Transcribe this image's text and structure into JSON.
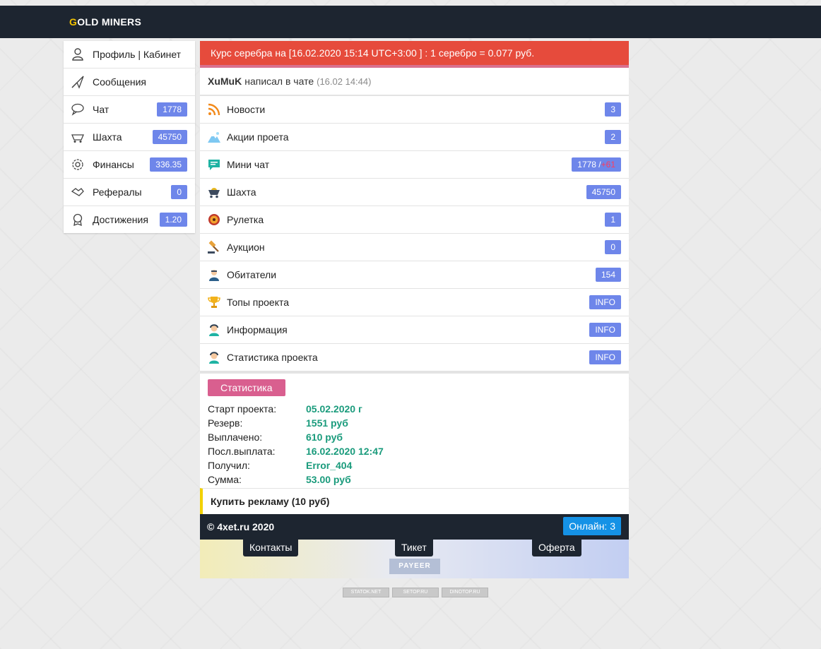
{
  "header": {
    "logo_first": "G",
    "logo_rest": "OLD MINERS"
  },
  "sidebar": {
    "items": [
      {
        "label": "Профиль | Кабинет",
        "icon": "user-icon"
      },
      {
        "label": "Сообщения",
        "icon": "paper-plane-icon"
      },
      {
        "label": "Чат",
        "icon": "chat-bubble-icon",
        "badge": "1778"
      },
      {
        "label": "Шахта",
        "icon": "mine-cart-icon",
        "badge": "45750"
      },
      {
        "label": "Финансы",
        "icon": "gear-coin-icon",
        "badge": "336.35"
      },
      {
        "label": "Рефералы",
        "icon": "handshake-icon",
        "badge": "0"
      },
      {
        "label": "Достижения",
        "icon": "medal-icon",
        "badge": "1.20"
      }
    ]
  },
  "rate_bar": {
    "text": "Курс серебра на [16.02.2020 15:14 UTC+3:00 ] : 1 серебро = 0.077 руб."
  },
  "chat_line": {
    "nick": "XuMuK",
    "text": "написал в чате",
    "time": "(16.02 14:44)"
  },
  "menu": {
    "items": [
      {
        "label": "Новости",
        "icon": "rss-icon",
        "badge": "3"
      },
      {
        "label": "Акции проета",
        "icon": "mountain-icon",
        "badge": "2"
      },
      {
        "label": "Мини чат",
        "icon": "message-icon",
        "badge": "1778 /",
        "badge_extra": "+61"
      },
      {
        "label": "Шахта",
        "icon": "mine-cart-icon",
        "badge": "45750"
      },
      {
        "label": "Рулетка",
        "icon": "roulette-icon",
        "badge": "1"
      },
      {
        "label": "Аукцион",
        "icon": "gavel-icon",
        "badge": "0"
      },
      {
        "label": "Обитатели",
        "icon": "people-icon",
        "badge": "154"
      },
      {
        "label": "Топы проекта",
        "icon": "trophy-icon",
        "badge": "INFO"
      },
      {
        "label": "Информация",
        "icon": "support-agent-icon",
        "badge": "INFO"
      },
      {
        "label": "Статистика проекта",
        "icon": "support-agent-icon",
        "badge": "INFO"
      }
    ]
  },
  "stats": {
    "title": "Статистика",
    "rows": [
      {
        "key": "Старт проекта:",
        "value": "05.02.2020 г"
      },
      {
        "key": "Резерв:",
        "value": "1551 руб"
      },
      {
        "key": "Выплачено:",
        "value": "610 руб"
      },
      {
        "key": "Посл.выплата:",
        "value": "16.02.2020 12:47"
      },
      {
        "key": "Получил:",
        "value": "Error_404"
      },
      {
        "key": "Сумма:",
        "value": "53.00 руб"
      }
    ]
  },
  "ad": {
    "text": "Купить рекламу (10 руб)"
  },
  "footer": {
    "copyright": "© 4xet.ru 2020",
    "online": "Онлайн: 3",
    "links": [
      "Контакты",
      "Тикет",
      "Оферта"
    ],
    "payeer": "PAYEER"
  },
  "counters": [
    "STATOK.NET",
    "SETOP.RU",
    "DINOTOP.RU"
  ],
  "colors": {
    "header_bg": "#1d2530",
    "badge": "#6e86ea",
    "rate_bar": "#e64b3c",
    "stat_value": "#1a9b7c",
    "online_btn": "#1592e6",
    "stats_title": "#d95f8f"
  }
}
